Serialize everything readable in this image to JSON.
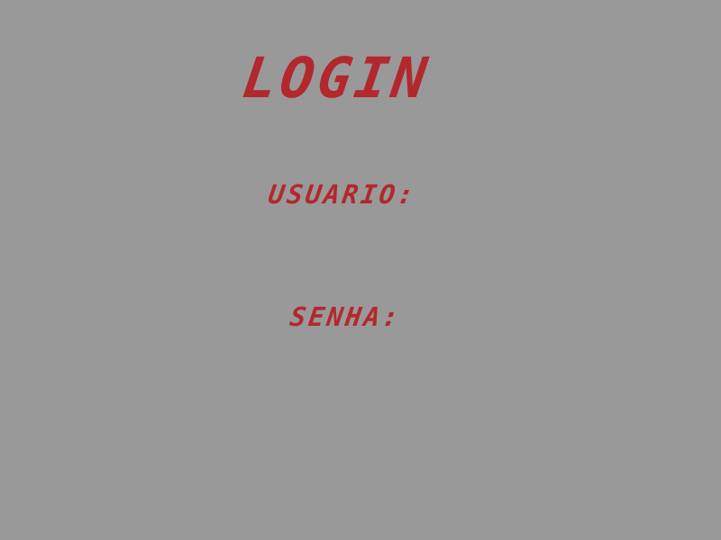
{
  "colors": {
    "background": "#999999",
    "text": "#B3282D"
  },
  "login": {
    "title": "LOGIN",
    "username_label": "USUARIO:",
    "username_value": "",
    "password_label": "SENHA:",
    "password_value": ""
  }
}
